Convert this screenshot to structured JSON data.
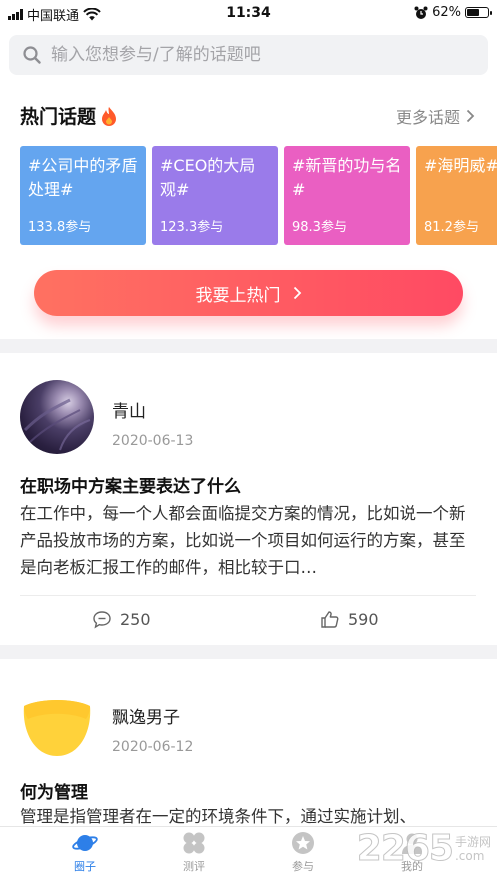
{
  "status_bar": {
    "carrier": "中国联通",
    "time": "11:34",
    "battery": "62%",
    "battery_level": 0.62
  },
  "search": {
    "placeholder": "输入您想参与/了解的话题吧"
  },
  "hot": {
    "title": "热门话题",
    "more_label": "更多话题",
    "topics": [
      {
        "title": "#公司中的矛盾处理#",
        "count": "133.8参与",
        "color": "#64a5ef"
      },
      {
        "title": "#CEO的大局观#",
        "count": "123.3参与",
        "color": "#9a7bea"
      },
      {
        "title": "#新晋的功与名#",
        "count": "98.3参与",
        "color": "#ea5fc2"
      },
      {
        "title": "#海明威#",
        "count": "81.2参与",
        "color": "#f7a24e"
      }
    ],
    "cta_label": "我要上热门"
  },
  "posts": [
    {
      "author": "青山",
      "date": "2020-06-13",
      "title": "在职场中方案主要表达了什么",
      "body": "在工作中，每一个人都会面临提交方案的情况，比如说一个新产品投放市场的方案，比如说一个项目如何运行的方案，甚至是向老板汇报工作的邮件，相比较于口…",
      "comments": "250",
      "likes": "590"
    },
    {
      "author": "飘逸男子",
      "date": "2020-06-12",
      "title": "何为管理",
      "body": "管理是指管理者在一定的环境条件下，通过实施计划、"
    }
  ],
  "tabs": [
    {
      "label": "圈子",
      "icon": "planet-icon",
      "active": true
    },
    {
      "label": "测评",
      "icon": "clover-icon",
      "active": false
    },
    {
      "label": "参与",
      "icon": "star-badge-icon",
      "active": false
    },
    {
      "label": "我的",
      "icon": "user-icon",
      "active": false
    }
  ],
  "watermark": {
    "number": "2265",
    "line1": "手游网",
    "line2": ".com"
  },
  "colors": {
    "accent": "#2d7fe8",
    "cta_start": "#ff7161",
    "cta_end": "#ff4a63"
  }
}
